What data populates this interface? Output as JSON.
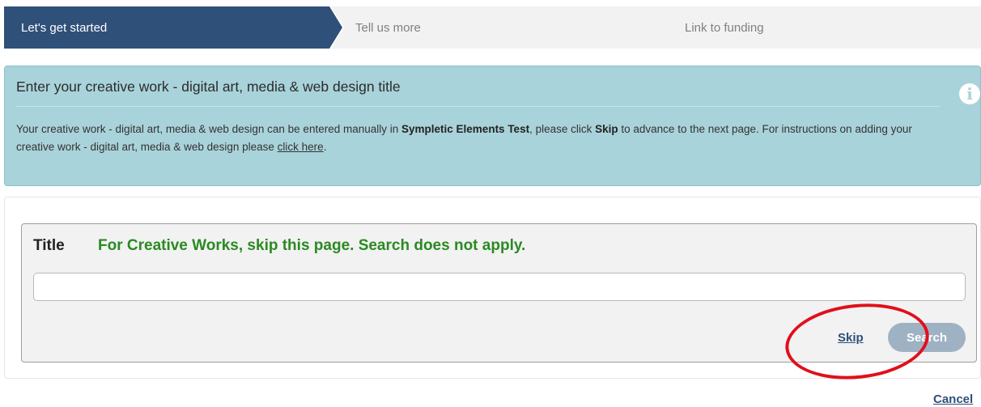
{
  "stepper": {
    "steps": [
      {
        "label": "Let's get started"
      },
      {
        "label": "Tell us more"
      },
      {
        "label": "Link to funding"
      }
    ]
  },
  "info": {
    "title": "Enter your creative work - digital art, media & web design title",
    "text_part1": "Your creative work - digital art, media & web design can be entered manually in ",
    "system_name": "Sympletic Elements Test",
    "text_part2": ", please click ",
    "skip_word": "Skip",
    "text_part3": " to advance to the next page. For instructions on adding your creative work - digital art, media & web design please ",
    "link_text": "click here",
    "text_part4": ".",
    "icon": "info-icon"
  },
  "search": {
    "label": "Title",
    "note": "For Creative Works, skip this page. Search does not apply.",
    "input_value": "",
    "skip_label": "Skip",
    "search_label": "Search"
  },
  "footer": {
    "cancel_label": "Cancel"
  },
  "colors": {
    "active_step": "#2f5079",
    "info_bg": "#a9d3da",
    "note_green": "#2a8a22",
    "highlight_red": "#e0101a",
    "search_button": "#9fb2c4"
  }
}
